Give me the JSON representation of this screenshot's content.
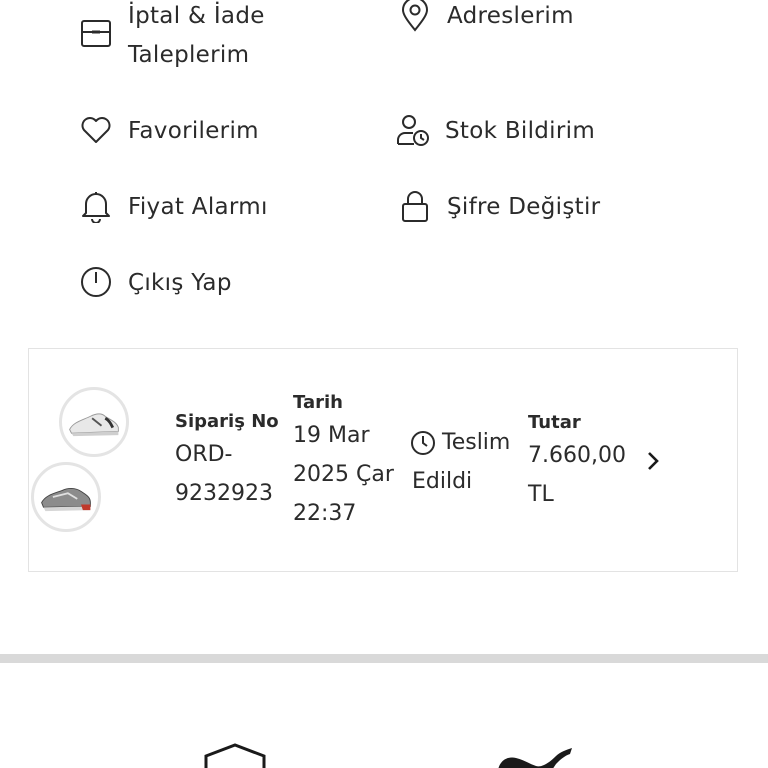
{
  "menu": {
    "items": [
      {
        "label": "İptal & İade\nTaleplerim",
        "icon": "box-icon"
      },
      {
        "label": "Adreslerim",
        "icon": "location-pin-icon"
      },
      {
        "label": "Favorilerim",
        "icon": "heart-icon"
      },
      {
        "label": "Stok Bildirim",
        "icon": "user-clock-icon"
      },
      {
        "label": "Fiyat Alarmı",
        "icon": "bell-icon"
      },
      {
        "label": "Şifre Değiştir",
        "icon": "lock-icon"
      },
      {
        "label": "Çıkış Yap",
        "icon": "power-icon"
      }
    ]
  },
  "order": {
    "order_no_label": "Sipariş No",
    "order_no": "ORD-\n9232923",
    "date_label": "Tarih",
    "date": "19 Mar\n2025 Çar\n22:37",
    "status": "Teslim\nEdildi",
    "total_label": "Tutar",
    "total": "7.660,00\nTL",
    "status_icon": "clock-icon",
    "chevron_icon": "chevron-right-icon"
  },
  "footer": {
    "left_logo_icon": "hexagon-logo-icon",
    "right_logo_icon": "puma-logo-icon"
  }
}
